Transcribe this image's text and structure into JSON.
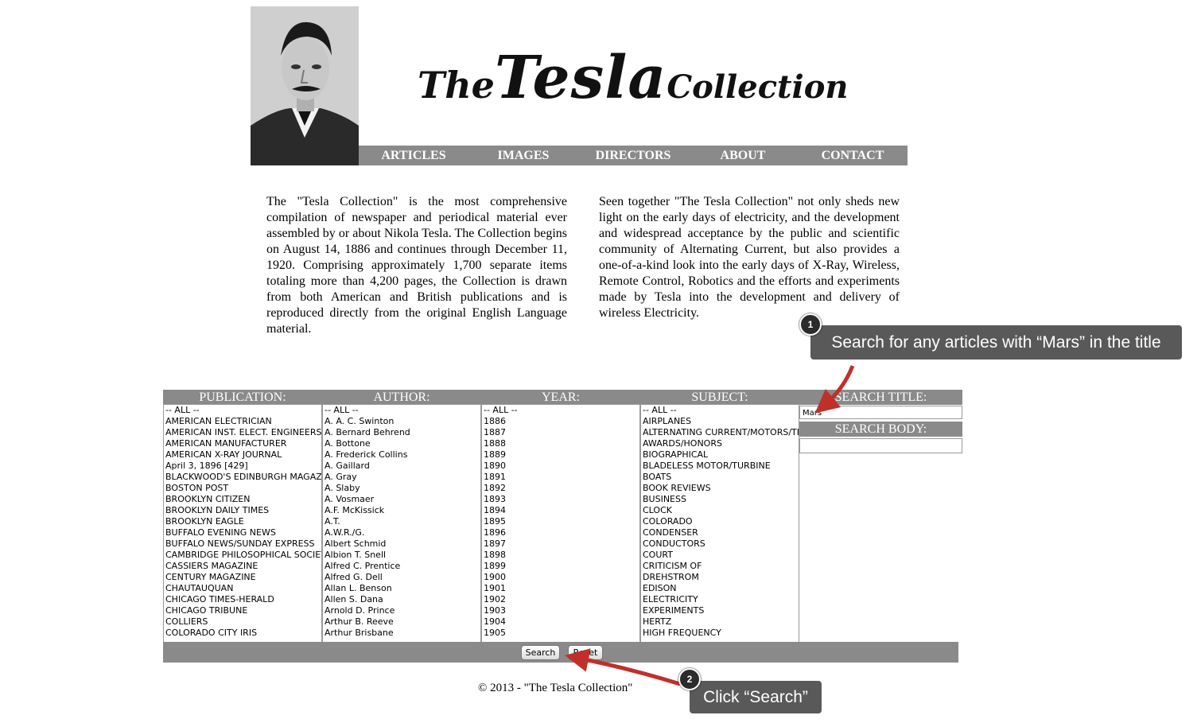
{
  "header": {
    "logo": {
      "the": "The",
      "tesla": "Tesla",
      "collection": "Collection"
    },
    "nav": [
      "ARTICLES",
      "IMAGES",
      "DIRECTORS",
      "ABOUT",
      "CONTACT"
    ]
  },
  "intro": {
    "left": "The \"Tesla Collection\" is the most comprehensive compilation of newspaper and periodical material ever assembled by or about Nikola Tesla. The Collection begins on August 14, 1886 and continues through December 11, 1920. Comprising approximately 1,700 separate items totaling more than 4,200 pages, the Collection is drawn from both American and British publications and is reproduced directly from the original English Language material.",
    "right": "Seen together \"The Tesla Collection\" not only sheds new light on the early days of electricity, and the development and widespread acceptance by the public and scientific community of Alternating Current, but also provides a one-of-a-kind look into the early days of X-Ray, Wireless, Remote Control, Robotics and the efforts and experiments made by Tesla into the development and delivery of wireless Electricity."
  },
  "search": {
    "headers": {
      "publication": "PUBLICATION:",
      "author": "AUTHOR:",
      "year": "YEAR:",
      "subject": "SUBJECT:",
      "title": "SEARCH TITLE:",
      "body": "SEARCH BODY:"
    },
    "publication_options": [
      "-- ALL --",
      "AMERICAN ELECTRICIAN",
      "AMERICAN INST. ELECT. ENGINEERS -",
      "AMERICAN MANUFACTURER",
      "AMERICAN X-RAY JOURNAL",
      "April 3, 1896 [429]",
      "BLACKWOOD'S EDINBURGH MAGAZIN",
      "BOSTON POST",
      "BROOKLYN CITIZEN",
      "BROOKLYN DAILY TIMES",
      "BROOKLYN EAGLE",
      "BUFFALO EVENING NEWS",
      "BUFFALO NEWS/SUNDAY EXPRESS",
      "CAMBRIDGE PHILOSOPHICAL SOCIETY",
      "CASSIERS MAGAZINE",
      "CENTURY MAGAZINE",
      "CHAUTAUQUAN",
      "CHICAGO TIMES-HERALD",
      "CHICAGO TRIBUNE",
      "COLLIERS",
      "COLORADO CITY IRIS"
    ],
    "author_options": [
      "-- ALL --",
      "A. A. C. Swinton",
      "A. Bernard Behrend",
      "A. Bottone",
      "A. Frederick Collins",
      "A. Gaillard",
      "A. Gray",
      "A. Slaby",
      "A. Vosmaer",
      "A.F. McKissick",
      "A.T.",
      "A.W.R./G.",
      "Albert Schmid",
      "Albion T. Snell",
      "Alfred C. Prentice",
      "Alfred G. Dell",
      "Allan L. Benson",
      "Allen S. Dana",
      "Arnold D. Prince",
      "Arthur B. Reeve",
      "Arthur Brisbane"
    ],
    "year_options": [
      "-- ALL --",
      "1886",
      "1887",
      "1888",
      "1889",
      "1890",
      "1891",
      "1892",
      "1893",
      "1894",
      "1895",
      "1896",
      "1897",
      "1898",
      "1899",
      "1900",
      "1901",
      "1902",
      "1903",
      "1904",
      "1905"
    ],
    "subject_options": [
      "-- ALL --",
      "AIRPLANES",
      "ALTERNATING CURRENT/MOTORS/TR",
      "AWARDS/HONORS",
      "BIOGRAPHICAL",
      "BLADELESS MOTOR/TURBINE",
      "BOATS",
      "BOOK REVIEWS",
      "BUSINESS",
      "CLOCK",
      "COLORADO",
      "CONDENSER",
      "CONDUCTORS",
      "COURT",
      "CRITICISM OF",
      "DREHSTROM",
      "EDISON",
      "ELECTRICITY",
      "EXPERIMENTS",
      "HERTZ",
      "HIGH FREQUENCY"
    ],
    "title_value": "Mars",
    "body_value": "",
    "search_label": "Search",
    "reset_label": "Reset"
  },
  "footer": "© 2013 - \"The Tesla Collection\"",
  "annotations": {
    "step1": {
      "number": "1",
      "text": "Search for any articles with “Mars” in the title"
    },
    "step2": {
      "number": "2",
      "text": "Click “Search”"
    }
  },
  "colors": {
    "nav_bg": "#8a8a8a",
    "callout_bg": "#595959",
    "arrow": "#c0302a"
  }
}
